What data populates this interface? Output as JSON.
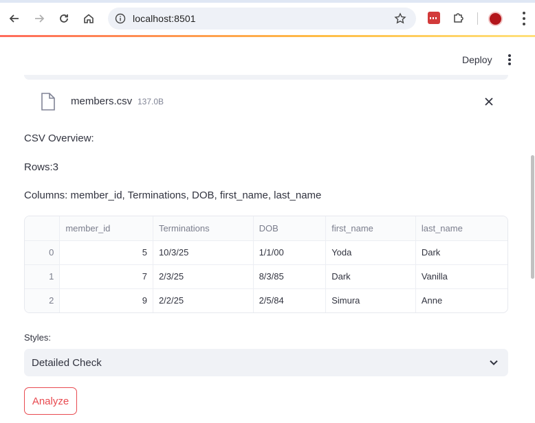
{
  "browser": {
    "url": "localhost:8501"
  },
  "app": {
    "deploy_label": "Deploy"
  },
  "uploader": {
    "file_name": "members.csv",
    "file_size": "137.0B"
  },
  "overview": {
    "heading": "CSV Overview:",
    "rows_text": "Rows:3",
    "columns_text": "Columns: member_id, Terminations, DOB, first_name, last_name"
  },
  "table": {
    "headers": [
      "",
      "member_id",
      "Terminations",
      "DOB",
      "first_name",
      "last_name"
    ],
    "rows": [
      [
        "0",
        "5",
        "10/3/25",
        "1/1/00",
        "Yoda",
        "Dark"
      ],
      [
        "1",
        "7",
        "2/3/25",
        "8/3/85",
        "Dark",
        "Vanilla"
      ],
      [
        "2",
        "9",
        "2/2/25",
        "2/5/84",
        "Simura",
        "Anne"
      ]
    ]
  },
  "styles": {
    "label": "Styles:",
    "selected": "Detailed Check"
  },
  "actions": {
    "analyze_label": "Analyze"
  },
  "colors": {
    "accent": "#e8494f",
    "select_bg": "#f0f2f6"
  }
}
